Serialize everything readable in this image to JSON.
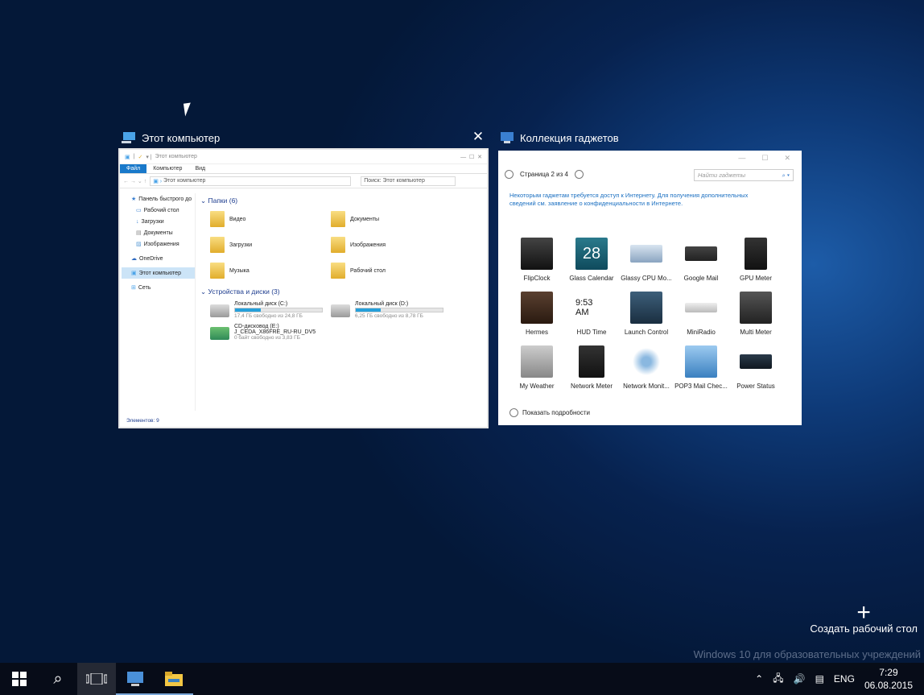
{
  "window1": {
    "title": "Этот компьютер",
    "titlebar_text": "Этот компьютер",
    "ribbon_tabs": [
      "Файл",
      "Компьютер",
      "Вид"
    ],
    "address": "Этот компьютер",
    "search_placeholder": "Поиск: Этот компьютер",
    "nav": [
      "Панель быстрого до",
      "Рабочий стол",
      "Загрузки",
      "Документы",
      "Изображения",
      "OneDrive",
      "Этот компьютер",
      "Сеть"
    ],
    "folders_header": "Папки (6)",
    "folders": [
      "Видео",
      "Документы",
      "Загрузки",
      "Изображения",
      "Музыка",
      "Рабочий стол"
    ],
    "devices_header": "Устройства и диски (3)",
    "drives": [
      {
        "name": "Локальный диск (C:)",
        "info": "17,4 ГБ свободно из 24,8 ГБ",
        "used": 0.3
      },
      {
        "name": "Локальный диск (D:)",
        "info": "6,25 ГБ свободно из 8,78 ГБ",
        "used": 0.29
      }
    ],
    "cd": {
      "name": "CD-дисковод (E:)",
      "label": "J_CEDA_X86FRE_RU-RU_DV5",
      "info": "0 байт свободно из 3,83 ГБ"
    },
    "status": "Элементов: 9"
  },
  "window2": {
    "title": "Коллекция гаджетов",
    "page": "Страница 2 из 4",
    "search_placeholder": "Найти гаджеты",
    "note": "Некоторым гаджетам требуется доступ к Интернету. Для получения дополнительных сведений см. заявление о конфиденциальности в Интернете.",
    "gadgets": [
      "FlipClock",
      "Glass Calendar",
      "Glassy CPU Mo...",
      "Google Mail",
      "GPU Meter",
      "Hermes",
      "HUD Time",
      "Launch Control",
      "MiniRadio",
      "Multi Meter",
      "My Weather",
      "Network Meter",
      "Network Monit...",
      "POP3 Mail Chec...",
      "Power Status"
    ],
    "calendar_day": "28",
    "hud_time": "9:53 AM",
    "more": "Показать подробности"
  },
  "new_desktop": "Создать рабочий стол",
  "watermark": "Windows 10 для образовательных учреждений",
  "tray": {
    "lang": "ENG",
    "time": "7:29",
    "date": "06.08.2015"
  },
  "colors": {
    "accent": "#1979ca",
    "taskbar": "#0a0e18"
  }
}
